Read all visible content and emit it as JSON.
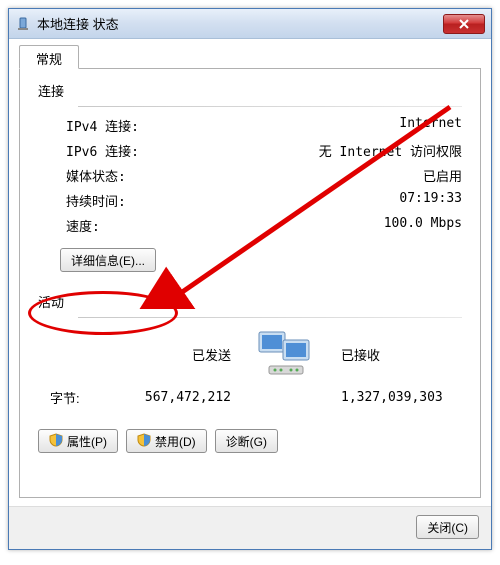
{
  "window": {
    "title": "本地连接 状态"
  },
  "tab": {
    "general": "常规"
  },
  "connection": {
    "heading": "连接",
    "ipv4_label": "IPv4 连接:",
    "ipv4_value": "Internet",
    "ipv6_label": "IPv6 连接:",
    "ipv6_value": "无 Internet 访问权限",
    "media_label": "媒体状态:",
    "media_value": "已启用",
    "duration_label": "持续时间:",
    "duration_value": "07:19:33",
    "speed_label": "速度:",
    "speed_value": "100.0 Mbps"
  },
  "buttons": {
    "details": "详细信息(E)...",
    "properties": "属性(P)",
    "disable": "禁用(D)",
    "diagnose": "诊断(G)",
    "close": "关闭(C)"
  },
  "activity": {
    "heading": "活动",
    "sent_label": "已发送",
    "recv_label": "已接收",
    "bytes_label": "字节:",
    "sent_value": "567,472,212",
    "recv_value": "1,327,039,303"
  }
}
